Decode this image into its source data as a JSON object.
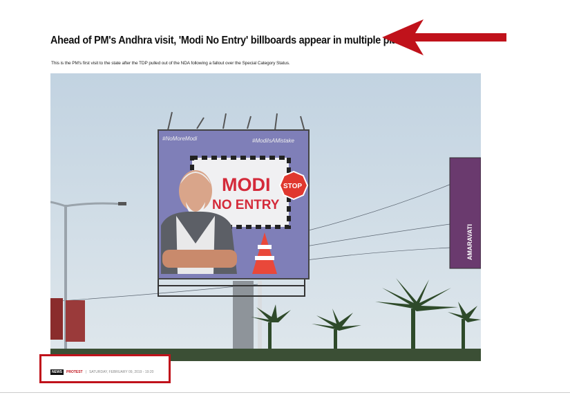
{
  "article": {
    "headline": "Ahead of PM's Andhra visit, 'Modi No Entry' billboards appear in multiple places",
    "subtitle": "This is the PM's first visit to the state after the TDP pulled out of the NDA following a fallout over the Special Category Status."
  },
  "photo": {
    "billboard_tag_left": "#NoMoreModi",
    "billboard_tag_right": "#ModiIsAMistake",
    "billboard_line1": "MODI",
    "billboard_line2": "NO ENTRY",
    "stop_sign": "STOP",
    "banner_text": "AMARAVATI"
  },
  "meta": {
    "badge": "NEWS",
    "category": "PROTEST",
    "separator": "|",
    "date": "SATURDAY, FEBRUARY 09, 2019 - 19:20"
  },
  "colors": {
    "highlight_red": "#c0121b",
    "arrow_red": "#c0121b"
  }
}
